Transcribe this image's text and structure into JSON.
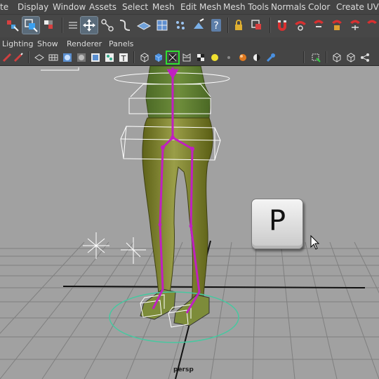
{
  "menubar": {
    "items": [
      "te",
      "Display",
      "Window",
      "Assets",
      "Select",
      "Mesh",
      "Edit Mesh",
      "Mesh Tools",
      "Normals",
      "Color",
      "Create UVs"
    ]
  },
  "panel_menu": {
    "items": [
      "Lighting",
      "Show",
      "Renderer",
      "Panels"
    ]
  },
  "viewport": {
    "camera_label": "persp"
  },
  "hotkey_overlay": {
    "key": "P"
  },
  "colors": {
    "viewport_bg": "#a1a1a1",
    "grid": "#7f7f7f",
    "skeleton": "#c020c0",
    "mesh_skin": "#8c8f3a",
    "wireframe": "#ffffff",
    "circle_control": "#46c8a0"
  },
  "shelf_icons": [
    "paint-select-icon",
    "lasso-select-icon",
    "paint-weights-icon",
    "soft-select-icon",
    "move-tool-icon",
    "joint-tool-icon",
    "curve-tool-icon",
    "plane-icon",
    "lattice-icon",
    "smooth-icon",
    "sculpt-icon",
    "help-icon",
    "lock-icon",
    "bind-skin-icon",
    "magnet-icon",
    "magnet-icon",
    "magnet-icon",
    "magnet-icon",
    "magnet-icon",
    "magnet-icon"
  ],
  "panel_icons": [
    "wireframe-icon",
    "shaded-icon",
    "smooth-shade-icon",
    "flat-shade-icon",
    "textured-icon",
    "text-icon",
    "cube-wire-icon",
    "cube-shaded-icon",
    "isolate-icon",
    "checker-icon",
    "light-icon",
    "shadow-icon",
    "sphere-icon",
    "xray-icon",
    "joint-xray-icon",
    "select-mode-icon",
    "cube-icon",
    "cube-icon",
    "share-icon"
  ]
}
